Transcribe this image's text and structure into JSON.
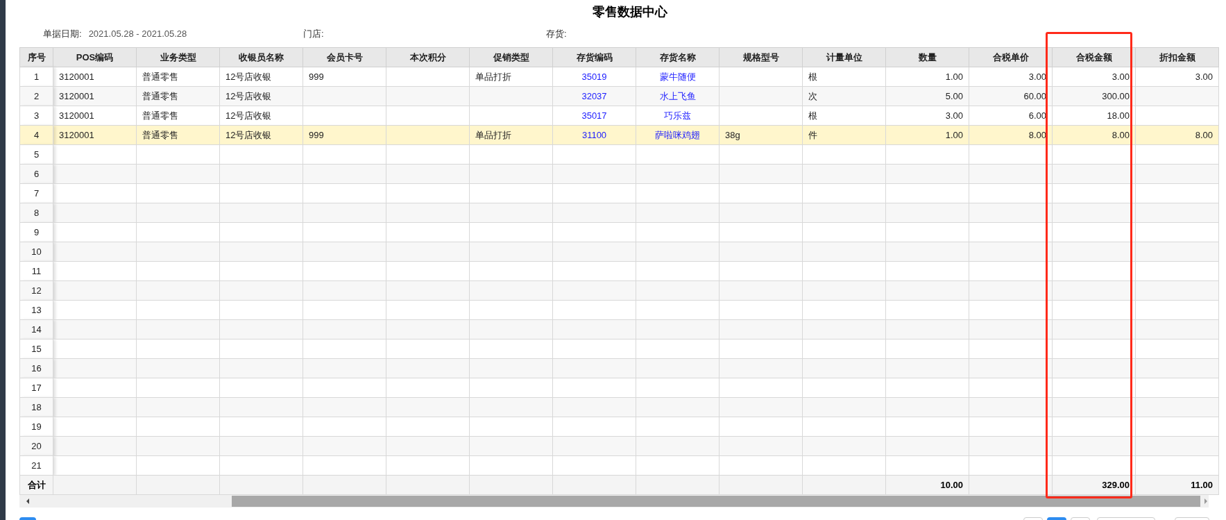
{
  "title": "零售数据中心",
  "filters": [
    {
      "label": "单据日期:",
      "value": "2021.05.28 - 2021.05.28"
    },
    {
      "label": "门店:"
    },
    {
      "label": "存货:"
    }
  ],
  "table": {
    "columns": [
      {
        "label": "序号",
        "kind": "index"
      },
      {
        "label": "POS编码",
        "kind": "text"
      },
      {
        "label": "业务类型",
        "kind": "text"
      },
      {
        "label": "收银员名称",
        "kind": "text"
      },
      {
        "label": "会员卡号",
        "kind": "text"
      },
      {
        "label": "本次积分",
        "kind": "text"
      },
      {
        "label": "促销类型",
        "kind": "text"
      },
      {
        "label": "存货编码",
        "kind": "link"
      },
      {
        "label": "存货名称",
        "kind": "link"
      },
      {
        "label": "规格型号",
        "kind": "text"
      },
      {
        "label": "计量单位",
        "kind": "text"
      },
      {
        "label": "数量",
        "kind": "number"
      },
      {
        "label": "合税单价",
        "kind": "number"
      },
      {
        "label": "合税金额",
        "kind": "number"
      },
      {
        "label": "折扣金额",
        "kind": "number"
      }
    ],
    "rows": [
      {
        "selected": false,
        "seq": "1",
        "pos_code": "3120001",
        "business_type": "普通零售",
        "cashier": "12号店收银",
        "member_card": "999",
        "promotion": "单品打折",
        "item_code": "35019",
        "item_name": "蒙牛随便",
        "unit": "根",
        "qty": "1.00",
        "unit_price": "3.00",
        "amount": "3.00",
        "discount": "3.00"
      },
      {
        "selected": false,
        "seq": "2",
        "pos_code": "3120001",
        "business_type": "普通零售",
        "cashier": "12号店收银",
        "item_code": "32037",
        "item_name": "水上飞鱼",
        "unit": "次",
        "qty": "5.00",
        "unit_price": "60.00",
        "amount": "300.00"
      },
      {
        "selected": false,
        "seq": "3",
        "pos_code": "3120001",
        "business_type": "普通零售",
        "cashier": "12号店收银",
        "item_code": "35017",
        "item_name": "巧乐兹",
        "unit": "根",
        "qty": "3.00",
        "unit_price": "6.00",
        "amount": "18.00"
      },
      {
        "selected": true,
        "seq": "4",
        "pos_code": "3120001",
        "business_type": "普通零售",
        "cashier": "12号店收银",
        "member_card": "999",
        "promotion": "单品打折",
        "item_code": "31100",
        "item_name": "萨啦咪鸡翅",
        "spec": "38g",
        "unit": "件",
        "qty": "1.00",
        "unit_price": "8.00",
        "amount": "8.00",
        "discount": "8.00"
      },
      {
        "selected": false,
        "seq": "5"
      },
      {
        "selected": false,
        "seq": "6"
      },
      {
        "selected": false,
        "seq": "7"
      },
      {
        "selected": false,
        "seq": "8"
      },
      {
        "selected": false,
        "seq": "9"
      },
      {
        "selected": false,
        "seq": "10"
      },
      {
        "selected": false,
        "seq": "11"
      },
      {
        "selected": false,
        "seq": "12"
      },
      {
        "selected": false,
        "seq": "13"
      },
      {
        "selected": false,
        "seq": "14"
      },
      {
        "selected": false,
        "seq": "15"
      },
      {
        "selected": false,
        "seq": "16"
      },
      {
        "selected": false,
        "seq": "17"
      },
      {
        "selected": false,
        "seq": "18"
      },
      {
        "selected": false,
        "seq": "19"
      },
      {
        "selected": false,
        "seq": "20"
      },
      {
        "selected": false,
        "seq": "21"
      }
    ],
    "totals": {
      "seq": "合计",
      "qty": "10.00",
      "amount": "329.00",
      "discount": "11.00"
    }
  }
}
